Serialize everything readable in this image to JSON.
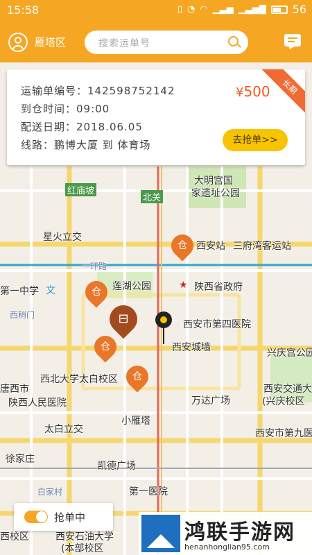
{
  "status_bar": {
    "time": "15:58",
    "battery": "56"
  },
  "header": {
    "district": "雁塔区",
    "search_placeholder": "搜索运单号"
  },
  "order": {
    "number_line": "运输单编号：142598752142",
    "arrive_line": "到仓时间：09:00",
    "date_line": "配送日期：2018.06.05",
    "route_line": "线路：鹏博大厦 到 体育场",
    "price_symbol": "¥",
    "price": "500",
    "ribbon": "长期",
    "grab_label": "去抢单>>"
  },
  "map_labels": {
    "hongmiaopo": "红庙坡",
    "beiguan": "北关",
    "daming": "大明宫国",
    "daming2": "家遗址公园",
    "xingshuli": "星火立交",
    "xian_station": "西安站",
    "sanfu": "三府湾客运站",
    "yierhuan": "一环路",
    "lianhu": "莲湖公园",
    "shengzhengfu": "陕西省政府",
    "diyizhongxue": "第一中学",
    "wen": "文",
    "ximalu": "西稍门",
    "siyiyuan": "西安市第四医院",
    "chengqiang": "西安城墙",
    "xingqinggong": "兴庆宫公园",
    "tangxishi": "唐西市",
    "xibeida": "西北大学太白校区",
    "jiaoda": "西安交通大",
    "jiaoda2": "(兴庆校区",
    "renminyiyuan": "陕西人民医院",
    "wandaguangchang": "万达广场",
    "xiaoyanta": "小雁塔",
    "taibai": "太白立交",
    "jiuyiyuan": "西安市第九医院",
    "xujiazhuang": "徐家庄",
    "kaide": "凯德广场",
    "bajiacun": "白家村",
    "diyiyiyuan": "第一医院",
    "shiyou": "西安石油大学",
    "shiyou2": "(本部校区",
    "xiaoqu": "西校区"
  },
  "toggle": {
    "label": "抢单中",
    "on": true
  },
  "watermark": {
    "title": "鸿联手游网",
    "url": "henanhonglian95.com"
  },
  "colors": {
    "brand": "#f5a623",
    "price": "#f25a1f",
    "marker": "#e8772a",
    "grab": "#f8c300"
  },
  "markers": {
    "warehouse_glyph": "仓",
    "bus_glyph": "⊟"
  }
}
